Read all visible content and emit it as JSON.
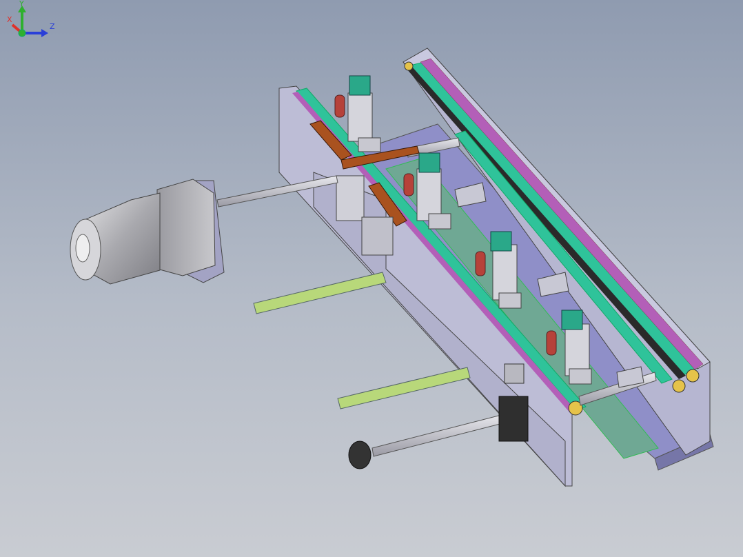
{
  "viewport": {
    "background_top": "#8f9bb0",
    "background_bottom": "#c9ccd2"
  },
  "colors": {
    "frame": "#b9b9d3",
    "frame_dark": "#8d8db0",
    "belt_green": "#2fc39a",
    "belt_purple": "#b35fb8",
    "bracket_orange": "#a9521f",
    "rail_green": "#b8d87a",
    "cylinder_red": "#b6423a",
    "valve_teal": "#2aa889",
    "metal": "#c8c8cc",
    "axis_x": "#e0302a",
    "axis_y": "#2fb02f",
    "axis_z": "#2a3fd8"
  },
  "icons": {
    "triad": "coordinate-triad-icon"
  },
  "triad": {
    "x_label": "X",
    "y_label": "Y",
    "z_label": "Z"
  }
}
